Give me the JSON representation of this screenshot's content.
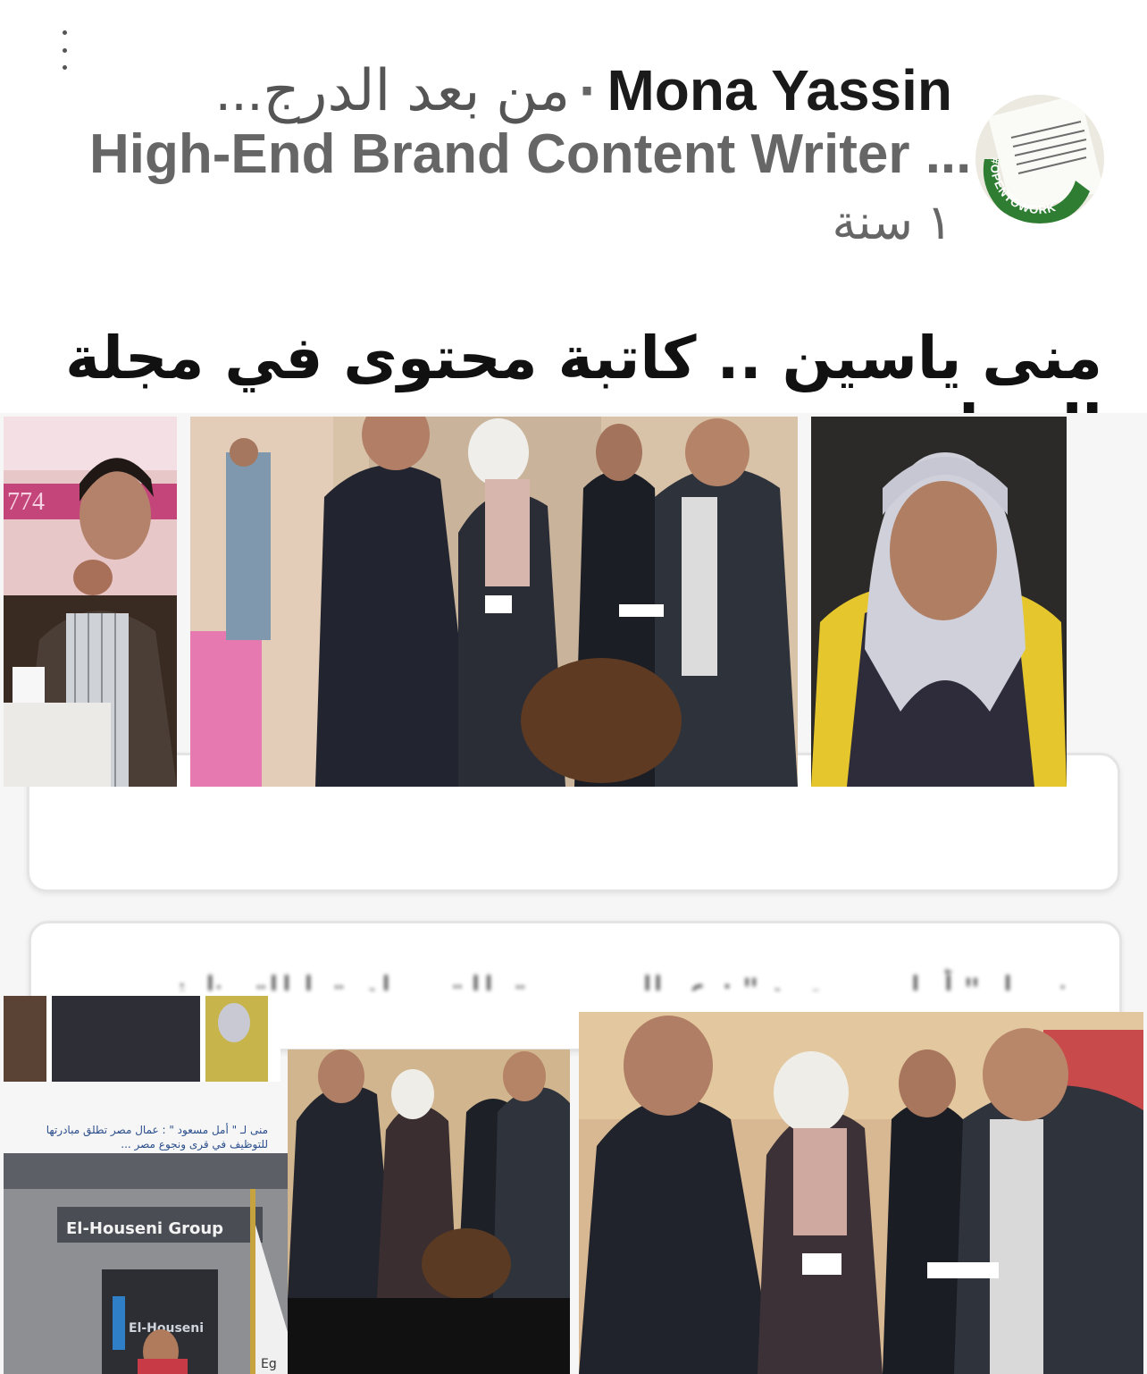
{
  "header": {
    "author_name": "Mona Yassin",
    "separator": "·",
    "connection_degree": "من بعد الدرج...",
    "headline": "High-End Brand Content Writer ...",
    "time_ago": "١ سنة",
    "avatar_badge": "#OPENTOWORK",
    "more_icon": "vertical-ellipsis-icon"
  },
  "post": {
    "title": "منى ياسين .. كاتبة محتوى في مجلة الرجل"
  },
  "media": {
    "banner_number": "774",
    "small_caption": "منى لـ \" أمل مسعود \" : عمال مصر تطلق مبادرتها للتوظيف في قرى ونجوع مصر ...",
    "sign_text": "El-Houseni Group",
    "sign_text_small": "El-Houseni",
    "flag_text": "Eg"
  },
  "colors": {
    "badge_green": "#2f7d32",
    "text_primary": "#1a1a1a",
    "text_secondary": "#666666"
  }
}
